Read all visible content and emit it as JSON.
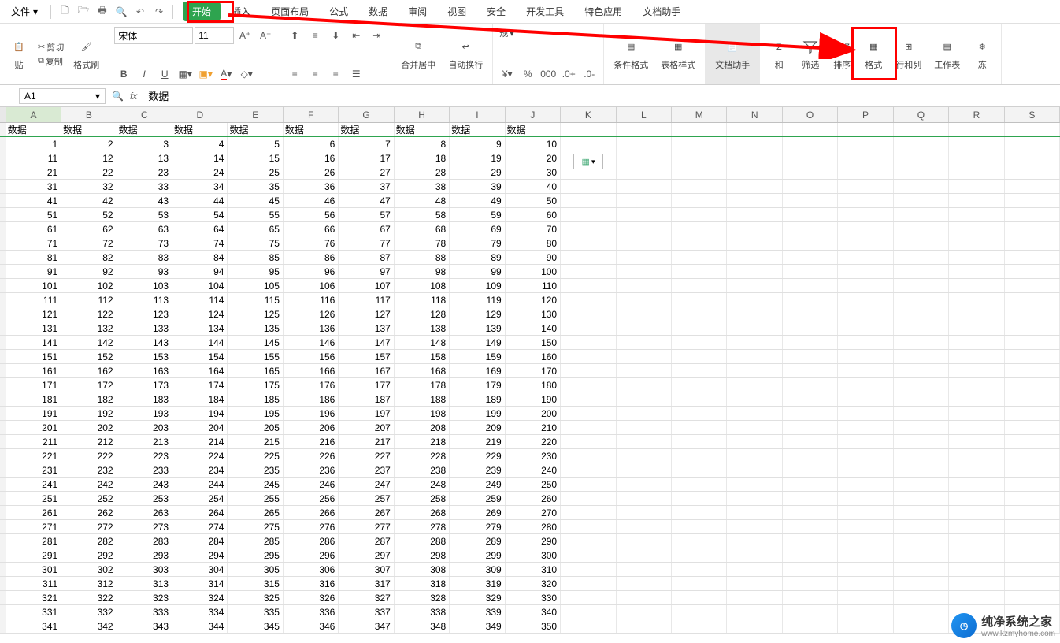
{
  "menu": {
    "file": "文件",
    "tabs": [
      "开始",
      "插入",
      "页面布局",
      "公式",
      "数据",
      "审阅",
      "视图",
      "安全",
      "开发工具",
      "特色应用",
      "文档助手"
    ]
  },
  "ribbon": {
    "paste": "贴",
    "cut": "剪切",
    "copy": "复制",
    "format_painter": "格式刷",
    "font_name": "宋体",
    "font_size": "11",
    "merge_center": "合并居中",
    "wrap": "自动换行",
    "currency": "规",
    "cond_fmt": "条件格式",
    "table_style": "表格样式",
    "doc_helper": "文档助手",
    "sum": "和",
    "filter": "筛选",
    "sort": "排序",
    "format": "格式",
    "row_col": "行和列",
    "worksheet": "工作表",
    "freeze": "冻"
  },
  "namebox": "A1",
  "formula": "数据",
  "columns": [
    "A",
    "B",
    "C",
    "D",
    "E",
    "F",
    "G",
    "H",
    "I",
    "J",
    "K",
    "L",
    "M",
    "N",
    "O",
    "P",
    "Q",
    "R",
    "S"
  ],
  "header_row": [
    "数据",
    "数据",
    "数据",
    "数据",
    "数据",
    "数据",
    "数据",
    "数据",
    "数据",
    "数据"
  ],
  "rows": 35,
  "cols": 10,
  "step": 10,
  "watermark": {
    "title": "纯净系统之家",
    "url": "www.kzmyhome.com"
  }
}
